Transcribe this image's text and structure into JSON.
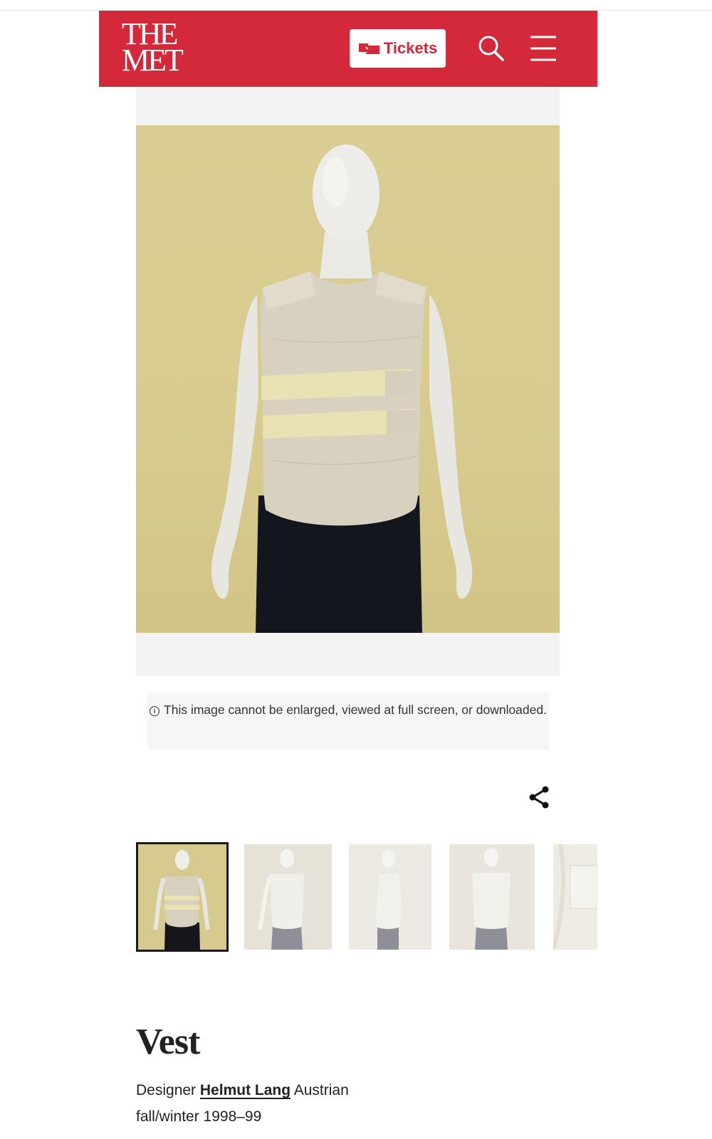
{
  "header": {
    "logo_line1": "THE",
    "logo_line2": "MET",
    "tickets_label": "Tickets",
    "search_icon": "search-icon",
    "menu_icon": "hamburger-menu-icon",
    "brand_color": "#d3293a"
  },
  "artwork_image": {
    "subject": "mannequin-wearing-vest"
  },
  "notice": {
    "text": "This image cannot be enlarged, viewed at full screen, or downloaded."
  },
  "share": {
    "icon": "share-icon"
  },
  "thumbnails": {
    "selected_index": 0,
    "items": [
      "front-view",
      "front-view-light",
      "side-view",
      "back-view",
      "label-detail"
    ]
  },
  "object": {
    "title": "Vest",
    "designer_prefix": "Designer",
    "designer_name": "Helmut Lang",
    "nationality": "Austrian",
    "date": "fall/winter 1998–99"
  }
}
